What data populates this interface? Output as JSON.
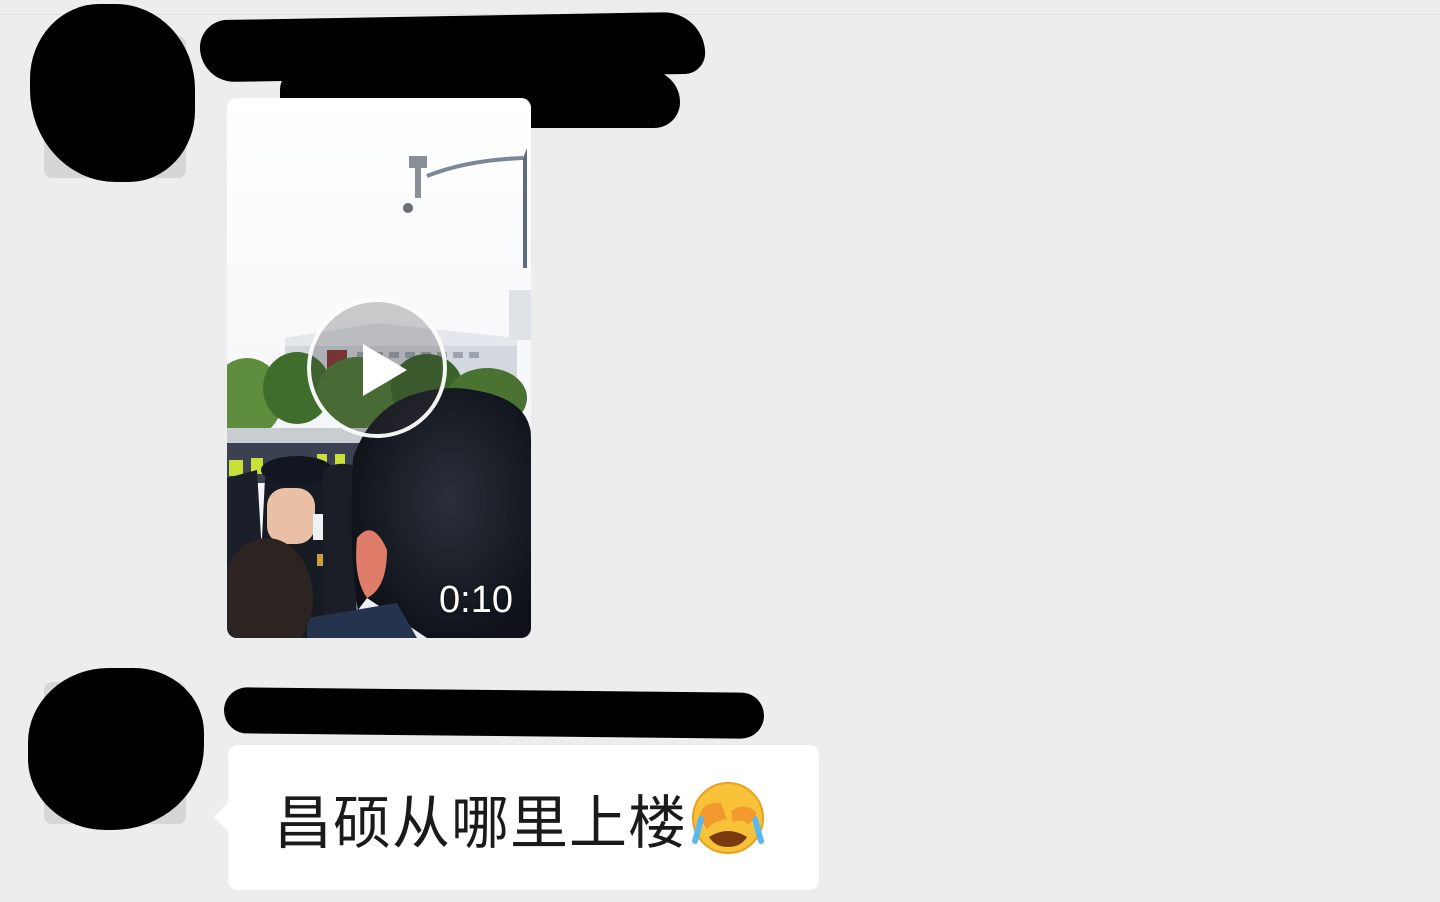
{
  "chat": {
    "messages": [
      {
        "type": "video",
        "sender_name": "",
        "duration": "0:10"
      },
      {
        "type": "text",
        "sender_name": "@",
        "text": "昌硕从哪里上楼",
        "emoji_icon": "face-with-hand-over-eyes-crying-icon"
      }
    ]
  },
  "colors": {
    "background": "#ededed",
    "bubble": "#ffffff",
    "redaction": "#000000"
  }
}
